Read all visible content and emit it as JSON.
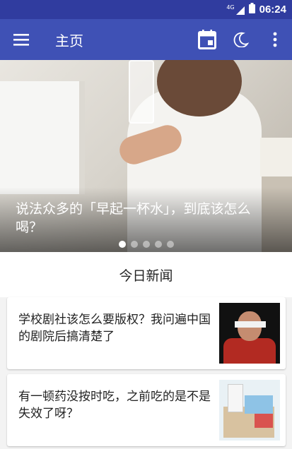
{
  "status_bar": {
    "network": "4G",
    "time": "06:24"
  },
  "app_bar": {
    "title": "主页",
    "icons": [
      "menu-icon",
      "calendar-icon",
      "moon-icon",
      "more-vert-icon"
    ]
  },
  "colors": {
    "status_bar": "#303c9f",
    "app_bar": "#3f51b5",
    "background": "#f3f3f3"
  },
  "hero": {
    "caption": "说法众多的「早起一杯水」，到底该怎么喝？",
    "slide_count": 5,
    "active_slide": 1
  },
  "section": {
    "title": "今日新闻"
  },
  "news": [
    {
      "title": "学校剧社该怎么要版权？我问遍中国的剧院后搞清楚了"
    },
    {
      "title": "有一顿药没按时吃，之前吃的是不是失效了呀？"
    }
  ]
}
